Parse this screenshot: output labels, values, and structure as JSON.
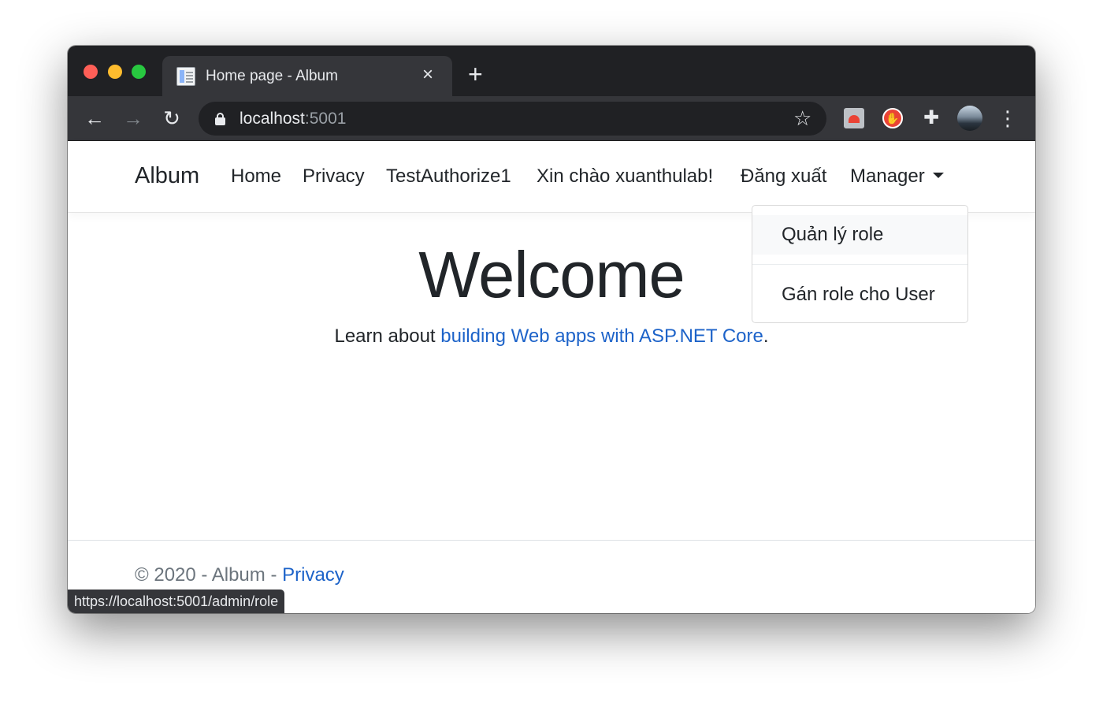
{
  "browser": {
    "tab": {
      "title": "Home page - Album",
      "close": "×"
    },
    "new_tab": "+",
    "nav": {
      "back": "←",
      "forward": "→",
      "reload": "↻"
    },
    "url": {
      "host": "localhost",
      "port": ":5001"
    },
    "bookmark_icon": "☆",
    "ext_block_glyph": "✋",
    "ext_puzzle_glyph": "✚",
    "menu_glyph": "⋮",
    "status_url": "https://localhost:5001/admin/role"
  },
  "navbar": {
    "brand": "Album",
    "links": [
      "Home",
      "Privacy",
      "TestAuthorize1"
    ],
    "greeting": "Xin chào xuanthulab!",
    "logout": "Đăng xuất",
    "manager": "Manager"
  },
  "dropdown": {
    "items": [
      "Quản lý role",
      "Gán role cho User"
    ]
  },
  "main": {
    "heading": "Welcome",
    "learn_prefix": "Learn about ",
    "learn_link": "building Web apps with ASP.NET Core",
    "learn_suffix": "."
  },
  "footer": {
    "text": "© 2020 - Album - ",
    "link": "Privacy"
  },
  "colors": {
    "link": "#1d63c9",
    "chrome_dark": "#202124",
    "chrome_tab": "#35363a"
  }
}
